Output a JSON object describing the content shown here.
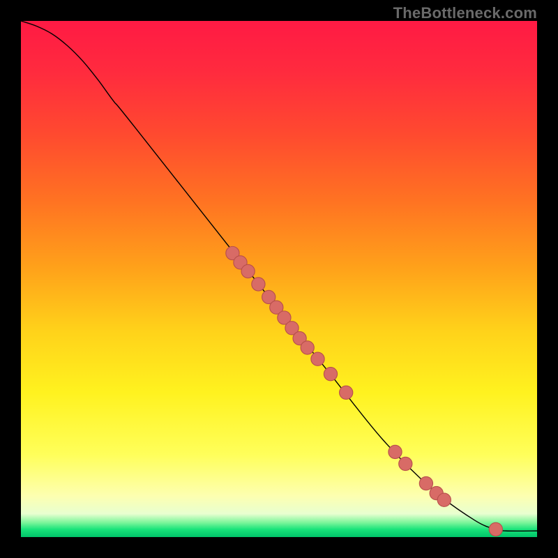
{
  "watermark": "TheBottleneck.com",
  "colors": {
    "gradient_stops": [
      {
        "offset": 0.0,
        "color": "#ff1a44"
      },
      {
        "offset": 0.1,
        "color": "#ff2b3e"
      },
      {
        "offset": 0.22,
        "color": "#ff4a2f"
      },
      {
        "offset": 0.35,
        "color": "#ff7322"
      },
      {
        "offset": 0.48,
        "color": "#ffa21a"
      },
      {
        "offset": 0.6,
        "color": "#ffd21a"
      },
      {
        "offset": 0.72,
        "color": "#fff21f"
      },
      {
        "offset": 0.84,
        "color": "#ffff5a"
      },
      {
        "offset": 0.92,
        "color": "#fdffb0"
      },
      {
        "offset": 0.955,
        "color": "#e8ffd0"
      },
      {
        "offset": 0.972,
        "color": "#7cf59a"
      },
      {
        "offset": 0.985,
        "color": "#19e37a"
      },
      {
        "offset": 1.0,
        "color": "#00c46a"
      }
    ],
    "curve_stroke": "#000000",
    "point_fill": "#d86b66",
    "point_stroke": "#b74f4b"
  },
  "chart_data": {
    "type": "line",
    "title": "",
    "xlabel": "",
    "ylabel": "",
    "xlim": [
      0,
      100
    ],
    "ylim": [
      0,
      100
    ],
    "series": [
      {
        "name": "curve",
        "x": [
          0,
          3,
          6,
          9,
          12,
          15,
          18,
          22,
          50,
          60,
          70,
          80,
          88,
          92,
          94,
          100
        ],
        "y": [
          100,
          99.0,
          97.5,
          95.2,
          92.2,
          88.5,
          84.4,
          79.5,
          44.0,
          31.5,
          19.0,
          9.0,
          3.2,
          1.5,
          1.2,
          1.2
        ]
      }
    ],
    "scatter": [
      {
        "name": "points",
        "points": [
          {
            "x": 41.0,
            "y": 55.0
          },
          {
            "x": 42.5,
            "y": 53.2
          },
          {
            "x": 44.0,
            "y": 51.5
          },
          {
            "x": 46.0,
            "y": 49.0
          },
          {
            "x": 48.0,
            "y": 46.5
          },
          {
            "x": 49.5,
            "y": 44.5
          },
          {
            "x": 51.0,
            "y": 42.5
          },
          {
            "x": 52.5,
            "y": 40.5
          },
          {
            "x": 54.0,
            "y": 38.5
          },
          {
            "x": 55.5,
            "y": 36.7
          },
          {
            "x": 57.5,
            "y": 34.5
          },
          {
            "x": 60.0,
            "y": 31.6
          },
          {
            "x": 63.0,
            "y": 28.0
          },
          {
            "x": 72.5,
            "y": 16.5
          },
          {
            "x": 74.5,
            "y": 14.2
          },
          {
            "x": 78.5,
            "y": 10.4
          },
          {
            "x": 80.5,
            "y": 8.5
          },
          {
            "x": 82.0,
            "y": 7.2
          },
          {
            "x": 92.0,
            "y": 1.5
          }
        ]
      }
    ]
  }
}
